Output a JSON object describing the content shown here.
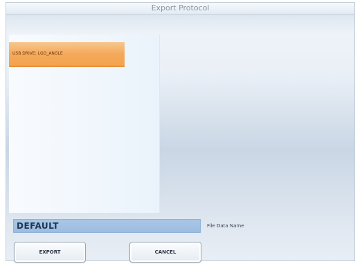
{
  "window": {
    "title": "Export Protocol"
  },
  "destination_list": {
    "items": [
      {
        "label": "USB DRIVE: LGO_ANGLE",
        "selected": true
      }
    ]
  },
  "file_name": {
    "value": "DEFAULT",
    "label": "File Data Name"
  },
  "buttons": {
    "export_label": "EXPORT",
    "cancel_label": "CANCEL"
  },
  "colors": {
    "selection": "#f4a95a",
    "field": "#a9c6e6",
    "title_text": "#8a96a6"
  }
}
